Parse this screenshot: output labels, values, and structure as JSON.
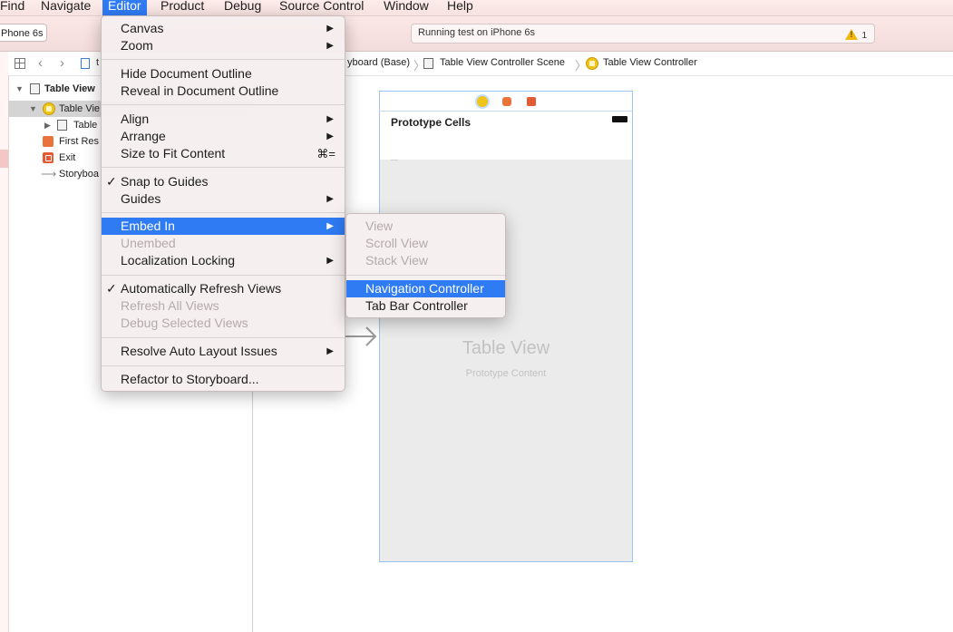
{
  "menubar": {
    "items": [
      "Find",
      "Navigate",
      "Editor",
      "Product",
      "Debug",
      "Source Control",
      "Window",
      "Help"
    ],
    "active": "Editor"
  },
  "toolbar": {
    "scheme": "Phone 6s",
    "status": "Running test on iPhone 6s",
    "warning_count": "1"
  },
  "jumpbar": {
    "crumbs": [
      "yboard (Base)",
      "Table View Controller Scene",
      "Table View Controller"
    ]
  },
  "outline": {
    "rows": [
      {
        "label": "Table View",
        "icon": "scene-icon"
      },
      {
        "label": "Table Vie",
        "icon": "view-controller-icon"
      },
      {
        "label": "Table",
        "icon": "table-view-icon"
      },
      {
        "label": "First Res",
        "icon": "first-responder-icon"
      },
      {
        "label": "Exit",
        "icon": "exit-icon"
      },
      {
        "label": "Storyboa",
        "icon": "arrow-icon"
      }
    ]
  },
  "canvas": {
    "prototype_cells": "Prototype Cells",
    "table_view_title": "Table View",
    "table_view_subtitle": "Prototype Content"
  },
  "editor_menu": {
    "items": [
      {
        "label": "Canvas",
        "submenu": true
      },
      {
        "label": "Zoom",
        "submenu": true
      },
      {
        "label": "Hide Document Outline"
      },
      {
        "label": "Reveal in Document Outline"
      },
      {
        "label": "Align",
        "submenu": true
      },
      {
        "label": "Arrange",
        "submenu": true
      },
      {
        "label": "Size to Fit Content",
        "shortcut": "⌘="
      },
      {
        "label": "Snap to Guides",
        "checked": true
      },
      {
        "label": "Guides",
        "submenu": true
      },
      {
        "label": "Embed In",
        "submenu": true,
        "highlighted": true
      },
      {
        "label": "Unembed",
        "disabled": true
      },
      {
        "label": "Localization Locking",
        "submenu": true
      },
      {
        "label": "Automatically Refresh Views",
        "checked": true
      },
      {
        "label": "Refresh All Views",
        "disabled": true
      },
      {
        "label": "Debug Selected Views",
        "disabled": true
      },
      {
        "label": "Resolve Auto Layout Issues",
        "submenu": true
      },
      {
        "label": "Refactor to Storyboard..."
      }
    ]
  },
  "embed_menu": {
    "items": [
      {
        "label": "View",
        "disabled": true
      },
      {
        "label": "Scroll View",
        "disabled": true
      },
      {
        "label": "Stack View",
        "disabled": true
      },
      {
        "label": "Navigation Controller",
        "highlighted": true
      },
      {
        "label": "Tab Bar Controller"
      }
    ]
  },
  "colors": {
    "highlight": "#2f7bf3",
    "menubar_tint": "#fdeceb",
    "selection_outline": "#9cc4ee",
    "warning": "#f2b80f"
  }
}
